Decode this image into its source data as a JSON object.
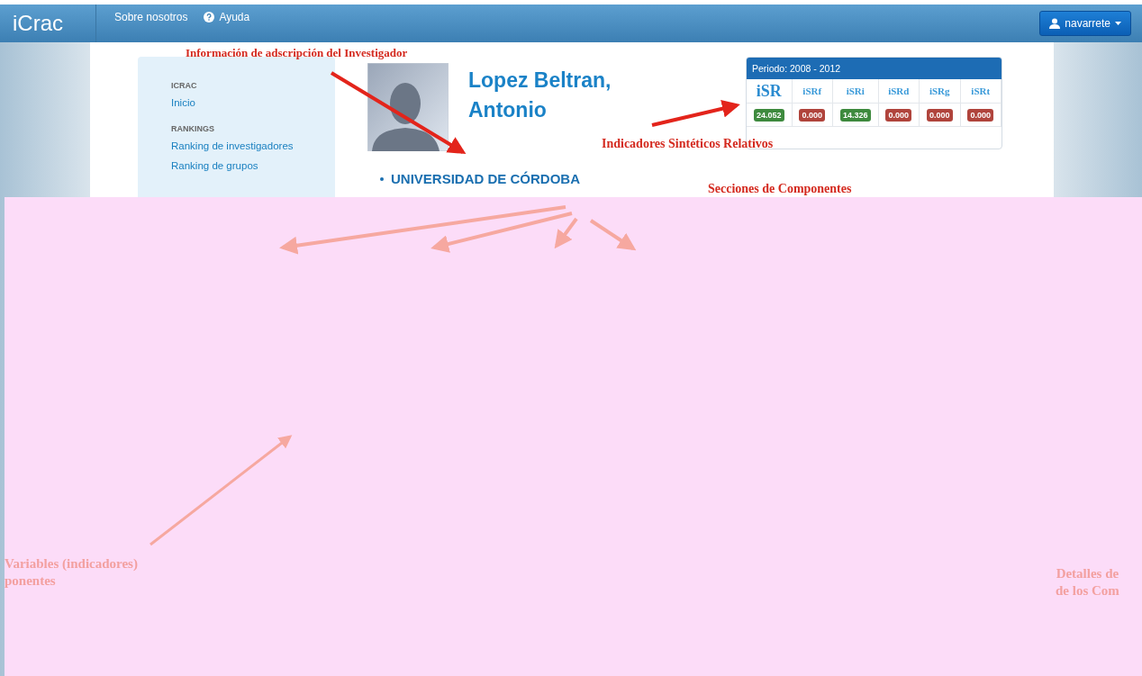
{
  "navbar": {
    "brand": "iCrac",
    "links": [
      {
        "label": "Sobre nosotros",
        "icon": false
      },
      {
        "label": "Ayuda",
        "icon": true
      }
    ],
    "user": "navarrete"
  },
  "sidebar": {
    "sections": [
      {
        "heading": "ICRAC",
        "items": [
          "Inicio"
        ]
      },
      {
        "heading": "RANKINGS",
        "items": [
          "Ranking de investigadores",
          "Ranking de grupos"
        ]
      }
    ]
  },
  "researcher": {
    "name_lines": [
      "Lopez Beltran,",
      "Antonio"
    ],
    "affiliation": "UNIVERSIDAD DE CÓRDOBA"
  },
  "indicators": {
    "period": "Periodo: 2008 - 2012",
    "items": [
      {
        "label": "iSR",
        "kind": "main",
        "value": "24.052",
        "color": "#3e8a3e"
      },
      {
        "label": "iSRf",
        "kind": "sub",
        "value": "0.000",
        "color": "#b0443c"
      },
      {
        "label": "iSRi",
        "kind": "sub",
        "value": "14.326",
        "color": "#3e8a3e"
      },
      {
        "label": "iSRd",
        "kind": "sub",
        "value": "0.000",
        "color": "#b0443c"
      },
      {
        "label": "iSRg",
        "kind": "sub",
        "value": "0.000",
        "color": "#b0443c"
      },
      {
        "label": "iSRt",
        "kind": "sub",
        "value": "0.000",
        "color": "#b0443c"
      }
    ]
  },
  "annotations": [
    {
      "lines": [
        "Información de adscripción del Investigador"
      ],
      "faded": false
    },
    {
      "lines": [
        "Indicadores Sintéticos Relativos"
      ],
      "faded": false
    },
    {
      "lines": [
        "Secciones de Componentes"
      ],
      "faded": false
    },
    {
      "lines": [
        "Variables (indicadores)",
        "ponentes"
      ],
      "faded": true
    },
    {
      "lines": [
        "Detalles de",
        "de los Com"
      ],
      "faded": true
    }
  ]
}
